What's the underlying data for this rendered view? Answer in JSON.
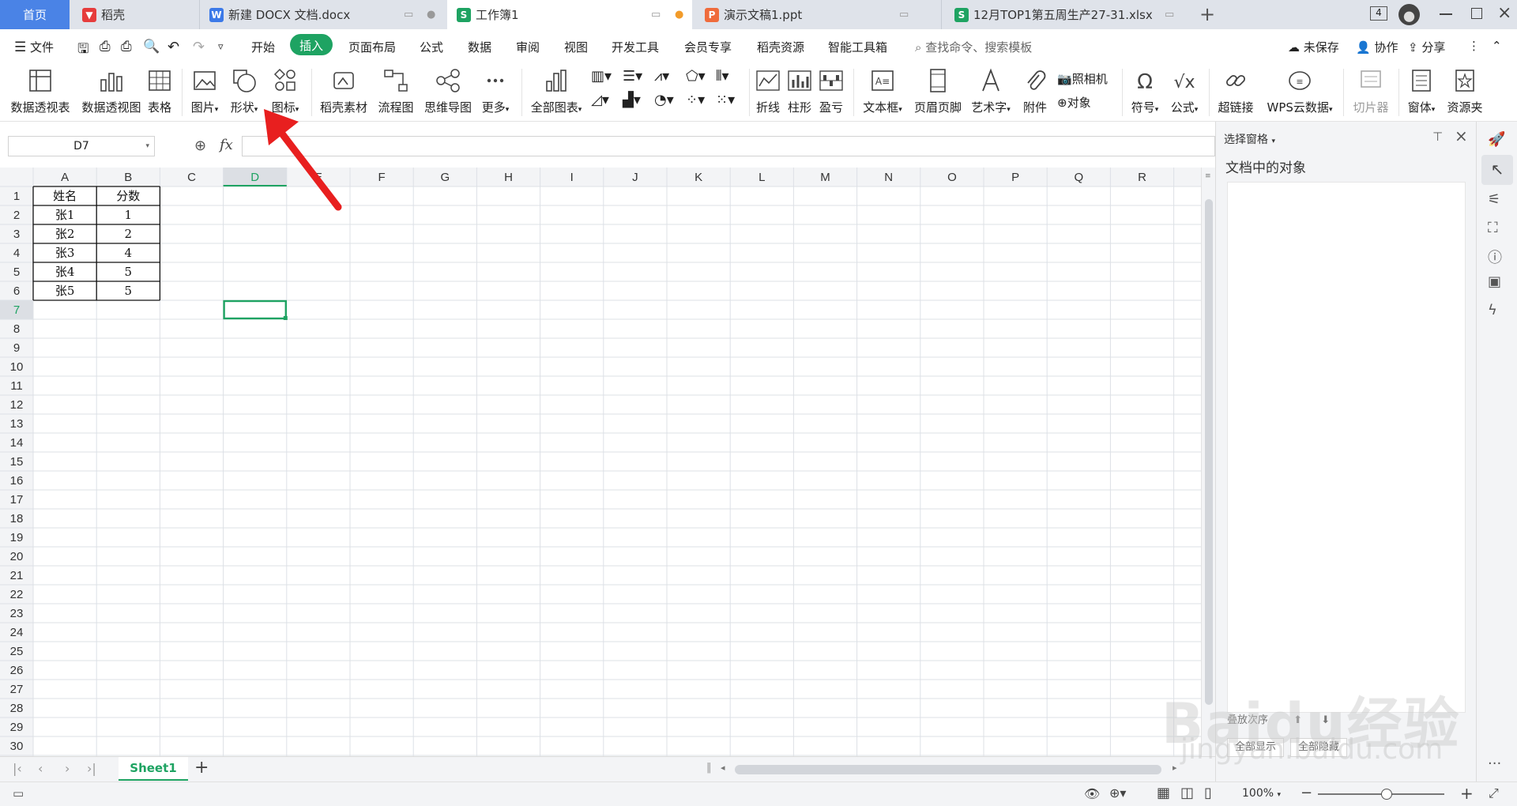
{
  "tabs": [
    {
      "label": "首页"
    },
    {
      "label": "稻壳"
    },
    {
      "label": "新建 DOCX 文档.docx"
    },
    {
      "label": "工作簿1"
    },
    {
      "label": "演示文稿1.ppt"
    },
    {
      "label": "12月TOP1第五周生产27-31.xlsx"
    }
  ],
  "tab_count": "4",
  "menu": {
    "file": "文件",
    "items": [
      "开始",
      "插入",
      "页面布局",
      "公式",
      "数据",
      "审阅",
      "视图",
      "开发工具",
      "会员专享",
      "稻壳资源",
      "智能工具箱"
    ],
    "search_placeholder": "查找命令、搜索模板",
    "unsaved": "未保存",
    "collab": "协作",
    "share": "分享"
  },
  "ribbon": {
    "pivot_table": "数据透视表",
    "pivot_chart": "数据透视图",
    "table": "表格",
    "picture": "图片",
    "shape": "形状",
    "icon": "图标",
    "daoke": "稻壳素材",
    "flow": "流程图",
    "mind": "思维导图",
    "more": "更多",
    "all_charts": "全部图表",
    "line": "折线",
    "column": "柱形",
    "winloss": "盈亏",
    "textbox": "文本框",
    "header_footer": "页眉页脚",
    "wordart": "艺术字",
    "attach": "附件",
    "camera": "照相机",
    "object": "对象",
    "symbol": "符号",
    "formula": "公式",
    "hyperlink": "超链接",
    "wps_cloud": "WPS云数据",
    "slicer": "切片器",
    "window": "窗体",
    "resource": "资源夹"
  },
  "formula_bar": {
    "name_box": "D7",
    "fx": "fx",
    "value": ""
  },
  "grid": {
    "columns": [
      "A",
      "B",
      "C",
      "D",
      "E",
      "F",
      "G",
      "H",
      "I",
      "J",
      "K",
      "L",
      "M",
      "N",
      "O",
      "P",
      "Q",
      "R"
    ],
    "rows": [
      [
        "姓名",
        "分数"
      ],
      [
        "张1",
        "1"
      ],
      [
        "张2",
        "2"
      ],
      [
        "张3",
        "4"
      ],
      [
        "张4",
        "5"
      ],
      [
        "张5",
        "5"
      ]
    ],
    "row_count": 30,
    "selected_cell": "D7"
  },
  "sheet": {
    "tab": "Sheet1"
  },
  "status": {
    "zoom": "100%"
  },
  "panel": {
    "title": "选择窗格",
    "subtitle": "文档中的对象",
    "reorder": "叠放次序",
    "show_all": "全部显示",
    "hide_all": "全部隐藏"
  },
  "watermark": {
    "brand": "Baidu经验",
    "url": "jingyan.baidu.com"
  },
  "colors": {
    "accent": "#1ea362",
    "grid_line": "#dadce0",
    "arrow": "#e81f1f",
    "tab_active": "#ffffff",
    "tab_bg": "#dfe3ea"
  }
}
